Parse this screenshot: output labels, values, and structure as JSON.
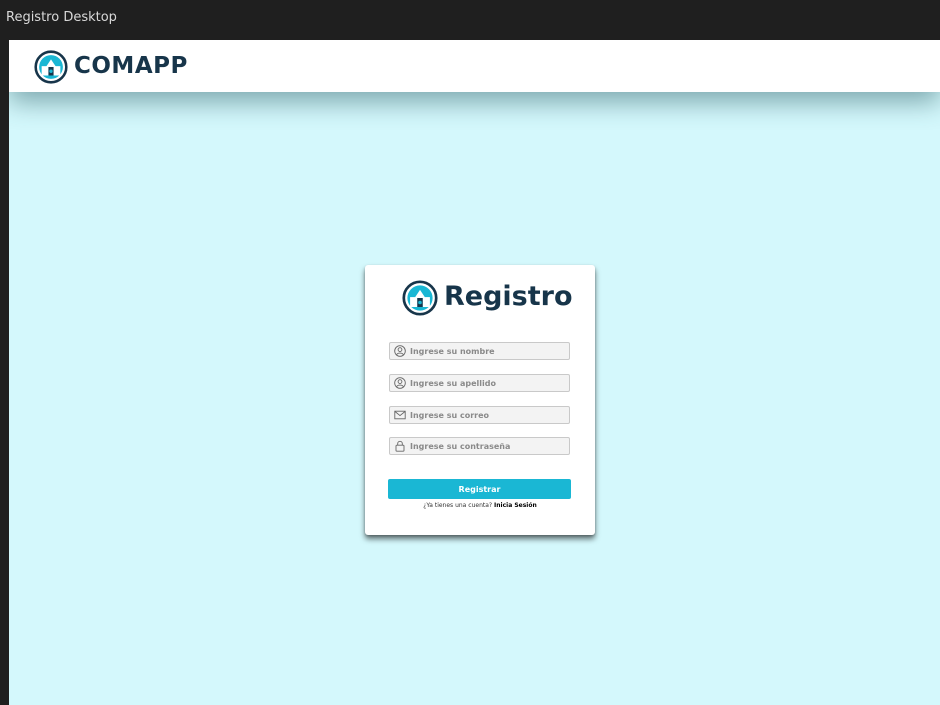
{
  "window": {
    "title": "Registro Desktop"
  },
  "header": {
    "brand": "COMAPP",
    "logo_icon": "comapp-logo-icon"
  },
  "card": {
    "title": "Registro",
    "logo_icon": "comapp-logo-icon",
    "fields": [
      {
        "placeholder": "Ingrese su nombre",
        "value": "",
        "icon": "user-icon"
      },
      {
        "placeholder": "Ingrese su apellido",
        "value": "",
        "icon": "user-icon"
      },
      {
        "placeholder": "Ingrese su correo",
        "value": "",
        "icon": "mail-icon"
      },
      {
        "placeholder": "Ingrese su contraseña",
        "value": "",
        "icon": "lock-icon"
      }
    ],
    "submit_label": "Registrar",
    "login_prompt": "¿Ya tienes una cuenta?",
    "login_link": "Inicia Sesión"
  },
  "colors": {
    "background": "#d4f8fc",
    "accent": "#1ab7d4",
    "brand_dark": "#17354a",
    "titlebar": "#1f1f1f"
  }
}
